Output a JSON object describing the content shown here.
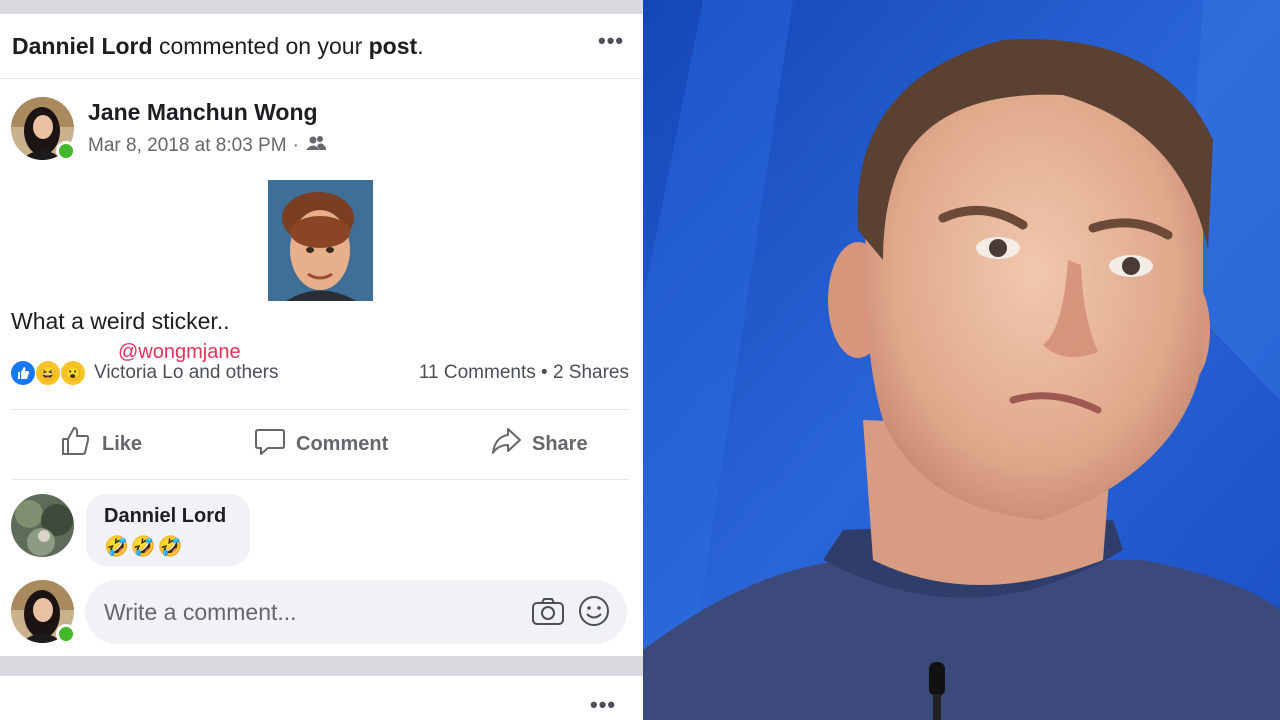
{
  "notification": {
    "actor": "Danniel Lord",
    "action": " commented on your ",
    "object": "post",
    "end": "."
  },
  "menu_icon": "more-dots-icon",
  "post": {
    "author": "Jane Manchun Wong",
    "timestamp": "Mar 8, 2018 at 8:03 PM",
    "separator": "·",
    "audience_icon": "friends-icon",
    "text": "What a weird sticker..",
    "watermark": "@wongmjane",
    "reaction_names": "Victoria Lo and others",
    "comments_count": "11 Comments",
    "shares_count": "2 Shares",
    "count_separator": " • "
  },
  "actions": {
    "like": "Like",
    "comment": "Comment",
    "share": "Share"
  },
  "comment": {
    "author": "Danniel Lord",
    "body": "🤣🤣🤣"
  },
  "composer": {
    "placeholder": "Write a comment..."
  },
  "colors": {
    "like_blue": "#1877f2",
    "online_green": "#42b72a",
    "watermark_red": "#e8315a",
    "background_blue": "#1d55c8"
  }
}
